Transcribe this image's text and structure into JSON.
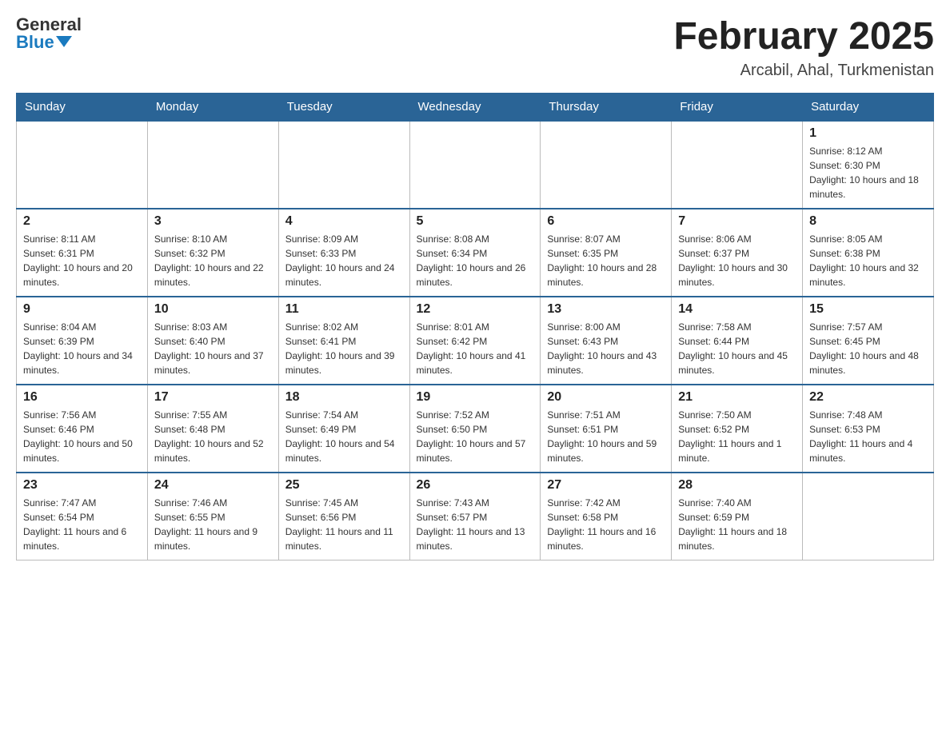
{
  "header": {
    "logo_general": "General",
    "logo_blue": "Blue",
    "month": "February 2025",
    "location": "Arcabil, Ahal, Turkmenistan"
  },
  "days_of_week": [
    "Sunday",
    "Monday",
    "Tuesday",
    "Wednesday",
    "Thursday",
    "Friday",
    "Saturday"
  ],
  "weeks": [
    [
      {
        "day": "",
        "info": ""
      },
      {
        "day": "",
        "info": ""
      },
      {
        "day": "",
        "info": ""
      },
      {
        "day": "",
        "info": ""
      },
      {
        "day": "",
        "info": ""
      },
      {
        "day": "",
        "info": ""
      },
      {
        "day": "1",
        "info": "Sunrise: 8:12 AM\nSunset: 6:30 PM\nDaylight: 10 hours and 18 minutes."
      }
    ],
    [
      {
        "day": "2",
        "info": "Sunrise: 8:11 AM\nSunset: 6:31 PM\nDaylight: 10 hours and 20 minutes."
      },
      {
        "day": "3",
        "info": "Sunrise: 8:10 AM\nSunset: 6:32 PM\nDaylight: 10 hours and 22 minutes."
      },
      {
        "day": "4",
        "info": "Sunrise: 8:09 AM\nSunset: 6:33 PM\nDaylight: 10 hours and 24 minutes."
      },
      {
        "day": "5",
        "info": "Sunrise: 8:08 AM\nSunset: 6:34 PM\nDaylight: 10 hours and 26 minutes."
      },
      {
        "day": "6",
        "info": "Sunrise: 8:07 AM\nSunset: 6:35 PM\nDaylight: 10 hours and 28 minutes."
      },
      {
        "day": "7",
        "info": "Sunrise: 8:06 AM\nSunset: 6:37 PM\nDaylight: 10 hours and 30 minutes."
      },
      {
        "day": "8",
        "info": "Sunrise: 8:05 AM\nSunset: 6:38 PM\nDaylight: 10 hours and 32 minutes."
      }
    ],
    [
      {
        "day": "9",
        "info": "Sunrise: 8:04 AM\nSunset: 6:39 PM\nDaylight: 10 hours and 34 minutes."
      },
      {
        "day": "10",
        "info": "Sunrise: 8:03 AM\nSunset: 6:40 PM\nDaylight: 10 hours and 37 minutes."
      },
      {
        "day": "11",
        "info": "Sunrise: 8:02 AM\nSunset: 6:41 PM\nDaylight: 10 hours and 39 minutes."
      },
      {
        "day": "12",
        "info": "Sunrise: 8:01 AM\nSunset: 6:42 PM\nDaylight: 10 hours and 41 minutes."
      },
      {
        "day": "13",
        "info": "Sunrise: 8:00 AM\nSunset: 6:43 PM\nDaylight: 10 hours and 43 minutes."
      },
      {
        "day": "14",
        "info": "Sunrise: 7:58 AM\nSunset: 6:44 PM\nDaylight: 10 hours and 45 minutes."
      },
      {
        "day": "15",
        "info": "Sunrise: 7:57 AM\nSunset: 6:45 PM\nDaylight: 10 hours and 48 minutes."
      }
    ],
    [
      {
        "day": "16",
        "info": "Sunrise: 7:56 AM\nSunset: 6:46 PM\nDaylight: 10 hours and 50 minutes."
      },
      {
        "day": "17",
        "info": "Sunrise: 7:55 AM\nSunset: 6:48 PM\nDaylight: 10 hours and 52 minutes."
      },
      {
        "day": "18",
        "info": "Sunrise: 7:54 AM\nSunset: 6:49 PM\nDaylight: 10 hours and 54 minutes."
      },
      {
        "day": "19",
        "info": "Sunrise: 7:52 AM\nSunset: 6:50 PM\nDaylight: 10 hours and 57 minutes."
      },
      {
        "day": "20",
        "info": "Sunrise: 7:51 AM\nSunset: 6:51 PM\nDaylight: 10 hours and 59 minutes."
      },
      {
        "day": "21",
        "info": "Sunrise: 7:50 AM\nSunset: 6:52 PM\nDaylight: 11 hours and 1 minute."
      },
      {
        "day": "22",
        "info": "Sunrise: 7:48 AM\nSunset: 6:53 PM\nDaylight: 11 hours and 4 minutes."
      }
    ],
    [
      {
        "day": "23",
        "info": "Sunrise: 7:47 AM\nSunset: 6:54 PM\nDaylight: 11 hours and 6 minutes."
      },
      {
        "day": "24",
        "info": "Sunrise: 7:46 AM\nSunset: 6:55 PM\nDaylight: 11 hours and 9 minutes."
      },
      {
        "day": "25",
        "info": "Sunrise: 7:45 AM\nSunset: 6:56 PM\nDaylight: 11 hours and 11 minutes."
      },
      {
        "day": "26",
        "info": "Sunrise: 7:43 AM\nSunset: 6:57 PM\nDaylight: 11 hours and 13 minutes."
      },
      {
        "day": "27",
        "info": "Sunrise: 7:42 AM\nSunset: 6:58 PM\nDaylight: 11 hours and 16 minutes."
      },
      {
        "day": "28",
        "info": "Sunrise: 7:40 AM\nSunset: 6:59 PM\nDaylight: 11 hours and 18 minutes."
      },
      {
        "day": "",
        "info": ""
      }
    ]
  ]
}
